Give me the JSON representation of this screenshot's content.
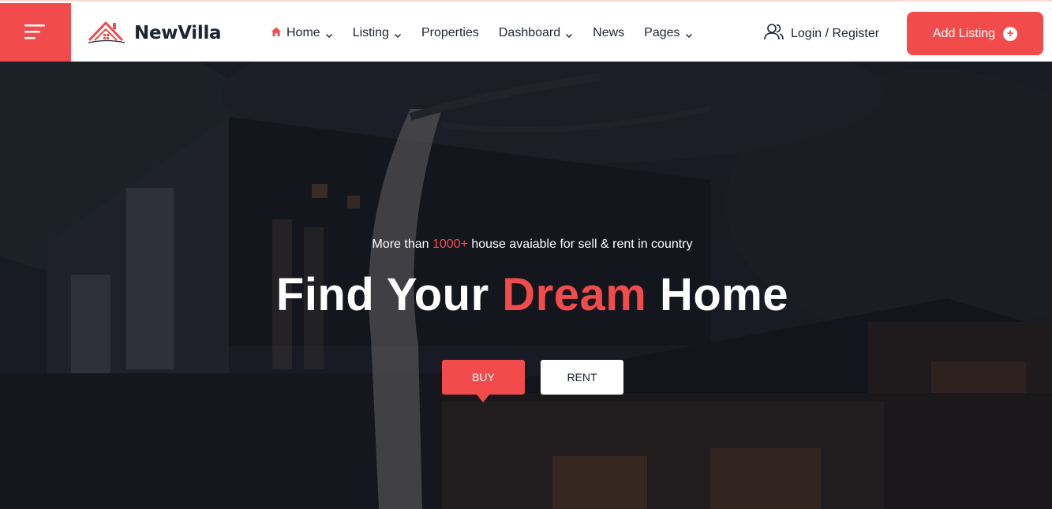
{
  "header": {
    "logo_text": "NewVilla",
    "nav": [
      {
        "label": "Home",
        "has_dropdown": true,
        "active": true
      },
      {
        "label": "Listing",
        "has_dropdown": true
      },
      {
        "label": "Properties",
        "has_dropdown": false
      },
      {
        "label": "Dashboard",
        "has_dropdown": true
      },
      {
        "label": "News",
        "has_dropdown": false
      },
      {
        "label": "Pages",
        "has_dropdown": true
      }
    ],
    "login_label": "Login / Register",
    "add_listing_label": "Add Listing"
  },
  "hero": {
    "subtitle_prefix": "More than ",
    "subtitle_accent": "1000+",
    "subtitle_suffix": " house avaiable for sell & rent in country",
    "headline_part1": "Find Your ",
    "headline_accent": "Dream",
    "headline_part2": " Home",
    "tabs": [
      {
        "label": "BUY",
        "active": true
      },
      {
        "label": "RENT",
        "active": false
      }
    ]
  },
  "colors": {
    "accent": "#f24b4b",
    "text_dark": "#1c2433",
    "header_bg": "#ffffff",
    "hero_overlay": "#1d2029"
  },
  "icons": [
    "menu-icon",
    "logo-house-icon",
    "home-icon",
    "chevron-down-icon",
    "user-icon",
    "plus-circle-icon"
  ]
}
